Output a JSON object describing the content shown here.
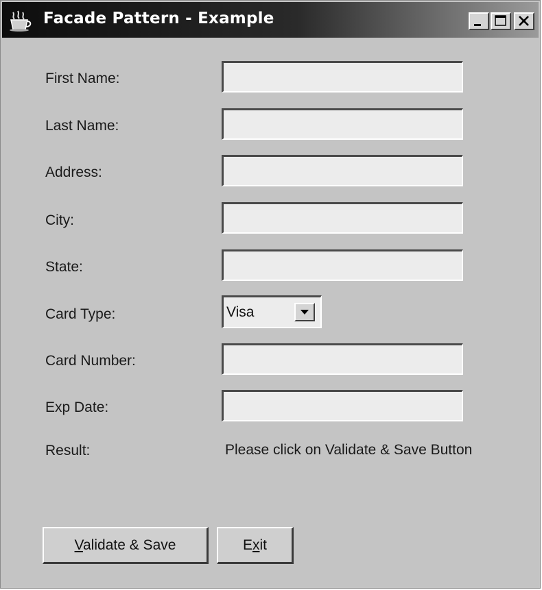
{
  "window": {
    "title": "Facade Pattern - Example",
    "icon": "coffee-cup-icon",
    "controls": [
      "minimize-icon",
      "maximize-icon",
      "close-icon"
    ]
  },
  "form": {
    "first_name_label": "First Name:",
    "last_name_label": "Last Name:",
    "address_label": "Address:",
    "city_label": "City:",
    "state_label": "State:",
    "card_type_label": "Card Type:",
    "card_type_value": "Visa",
    "card_number_label": "Card Number:",
    "exp_date_label": "Exp Date:",
    "result_label": "Result:",
    "result_value": "Please click on Validate & Save Button",
    "first_name_value": "",
    "last_name_value": "",
    "address_value": "",
    "city_value": "",
    "state_value": "",
    "card_number_value": "",
    "exp_date_value": ""
  },
  "buttons": {
    "validate_mnemonic": "V",
    "validate_rest": "alidate & Save",
    "exit_pre": "E",
    "exit_mnemonic": "x",
    "exit_post": "it"
  }
}
